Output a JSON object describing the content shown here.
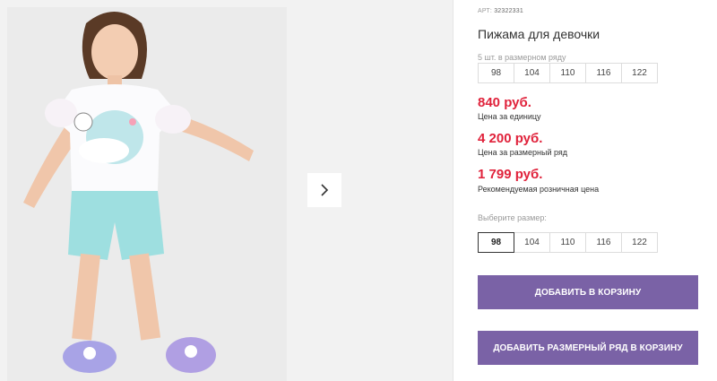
{
  "gallery": {
    "next_label": "next"
  },
  "product": {
    "art_label": "АРТ:",
    "art_number": "32322331",
    "title": "Пижама для девочки",
    "pack_hint": "5 шт. в размерном ряду",
    "pack_sizes": [
      "98",
      "104",
      "110",
      "116",
      "122"
    ],
    "prices": [
      {
        "value": "840 руб.",
        "label": "Цена за единицу"
      },
      {
        "value": "4 200 руб.",
        "label": "Цена за размерный ряд"
      },
      {
        "value": "1 799 руб.",
        "label": "Рекомендуемая розничная цена"
      }
    ],
    "choose_size_hint": "Выберите размер:",
    "choose_sizes": [
      "98",
      "104",
      "110",
      "116",
      "122"
    ],
    "selected_size": "98",
    "add_to_cart_label": "ДОБАВИТЬ В КОРЗИНУ",
    "add_pack_label": "ДОБАВИТЬ РАЗМЕРНЫЙ РЯД В КОРЗИНУ"
  },
  "colors": {
    "price": "#e0223b",
    "button": "#7a62a6"
  }
}
